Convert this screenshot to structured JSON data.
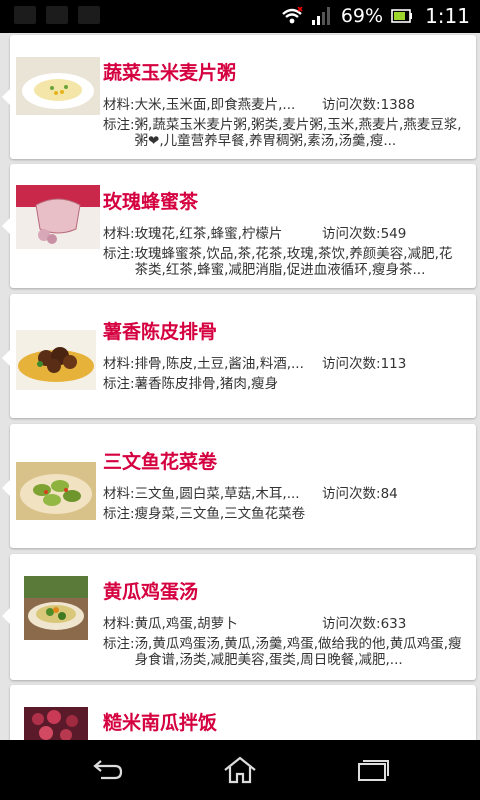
{
  "status_bar": {
    "battery_text": "69%",
    "time": "1:11",
    "icons": [
      "notification-icon",
      "wifi-icon",
      "signal-icon",
      "battery-icon"
    ]
  },
  "labels": {
    "material": "材料:",
    "visits": "访问次数:",
    "notes": "标注:"
  },
  "recipes": [
    {
      "title": "蔬菜玉米麦片粥",
      "materials": "大米,玉米面,即食燕麦片,...",
      "visits": "1388",
      "notes": "粥,蔬菜玉米麦片粥,粥类,麦片粥,玉米,燕麦片,燕麦豆浆,粥❤,儿童营养早餐,养胃稠粥,素汤,汤羹,瘦..."
    },
    {
      "title": "玫瑰蜂蜜茶",
      "materials": "玫瑰花,红茶,蜂蜜,柠檬片",
      "visits": "549",
      "notes": "玫瑰蜂蜜茶,饮品,茶,花茶,玫瑰,茶饮,养颜美容,减肥,花茶类,红茶,蜂蜜,减肥消脂,促进血液循环,瘦身茶..."
    },
    {
      "title": "薯香陈皮排骨",
      "materials": "排骨,陈皮,土豆,酱油,料酒,...",
      "visits": "113",
      "notes": "薯香陈皮排骨,猪肉,瘦身"
    },
    {
      "title": "三文鱼花菜卷",
      "materials": "三文鱼,圆白菜,草菇,木耳,...",
      "visits": "84",
      "notes": "瘦身菜,三文鱼,三文鱼花菜卷"
    },
    {
      "title": "黄瓜鸡蛋汤",
      "materials": "黄瓜,鸡蛋,胡萝卜",
      "visits": "633",
      "notes": "汤,黄瓜鸡蛋汤,黄瓜,汤羹,鸡蛋,做给我的他,黄瓜鸡蛋,瘦身食谱,汤类,减肥美容,蛋类,周日晚餐,减肥,..."
    },
    {
      "title": "糙米南瓜拌饭"
    }
  ],
  "nav_bar": {
    "icons": [
      "back-icon",
      "home-icon",
      "recent-apps-icon"
    ]
  },
  "colors": {
    "title": "#d5003f",
    "status_bar": "#000000",
    "background": "#e4e4e4"
  }
}
